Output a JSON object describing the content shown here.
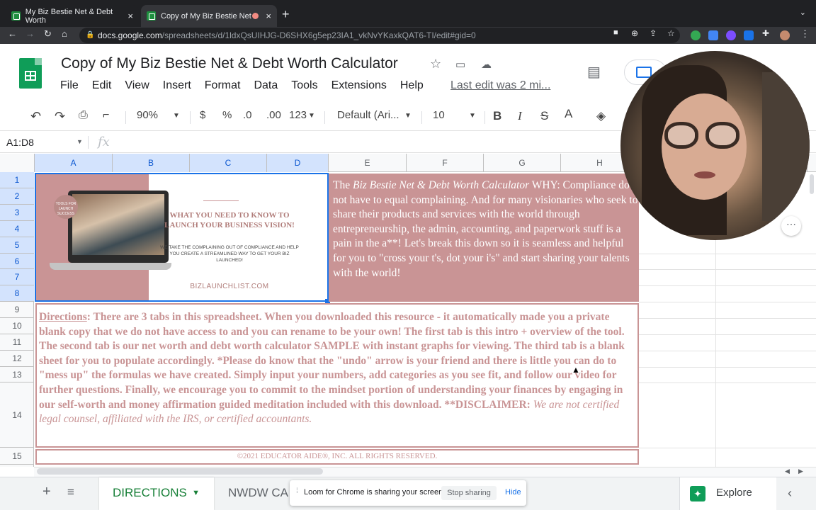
{
  "browser": {
    "tabs": [
      {
        "title": "My Biz Bestie Net & Debt Worth",
        "close": "×"
      },
      {
        "title": "Copy of My Biz Bestie Net",
        "close": "×"
      }
    ],
    "new_tab": "+",
    "url_domain": "docs.google.com",
    "url_path": "/spreadsheets/d/1ldxQsUIHJG-D6SHX6g5ep23IA1_vkNvYKaxkQAT6-TI/edit#gid=0"
  },
  "sheets": {
    "doc_title": "Copy of My Biz Bestie Net & Debt Worth Calculator",
    "menu": [
      "File",
      "Edit",
      "View",
      "Insert",
      "Format",
      "Data",
      "Tools",
      "Extensions",
      "Help"
    ],
    "last_edit": "Last edit was 2 mi...",
    "toolbar": {
      "zoom": "90%",
      "currency": "$",
      "percent": "%",
      "dec_less": ".0",
      "dec_more": ".00",
      "more_formats": "123",
      "font": "Default (Ari...",
      "font_size": "10",
      "bold": "B",
      "italic": "I",
      "strike": "S",
      "text_color": "A"
    },
    "name_box": "A1:D8",
    "fx": "fx",
    "columns": [
      "A",
      "B",
      "C",
      "D",
      "E",
      "F",
      "G",
      "H"
    ],
    "rows": [
      "1",
      "2",
      "3",
      "4",
      "5",
      "6",
      "7",
      "8",
      "9",
      "10",
      "11",
      "12",
      "13",
      "14",
      "15"
    ]
  },
  "image": {
    "badge": "TOOLS FOR LAUNCH SUCCESS",
    "heading": "WHAT YOU NEED TO KNOW TO LAUNCH YOUR BUSINESS VISION!",
    "subheading": "WE TAKE THE COMPLAINING OUT OF COMPLIANCE AND HELP YOU CREATE A STREAMLINED WAY TO GET YOUR BIZ LAUNCHED!",
    "url": "BIZLAUNCHLIST.COM"
  },
  "why": {
    "prefix": "The ",
    "italic": "Biz Bestie Net & Debt Worth Calculator",
    "body": " WHY: Compliance does not have to equal complaining. And for many visionaries who seek to share their products and services with the world through entrepreneurship, the admin, accounting, and paperwork stuff is a pain in the a**! Let's break this down so it is seamless and helpful for you to \"cross your t's, dot your i's\" and start sharing your talents with the world!"
  },
  "directions": {
    "label": "Directions",
    "body": ": There are 3 tabs in this spreadsheet. When you downloaded this resource - it automatically made you a private blank copy that we do not have access to and you can rename to be your own! The first tab is this intro + overview of the tool. The second tab is our net worth and debt worth calculator SAMPLE with instant graphs for viewing. The third tab is a blank sheet for you to populate accordingly. *Please do know that the \"undo\" arrow is your friend and there is little you can do to \"mess up\" the formulas we have created. Simply input your numbers, add categories as you see fit, and follow our video for further questions. Finally, we encourage you to commit to the mindset portion of understanding your finances by engaging in our self-worth and money affirmation guided meditation included with this download. **DISCLAIMER: ",
    "disclaimer": "We are not certified legal counsel, affiliated with the IRS, or certified accountants."
  },
  "copyright": "©2021 EDUCATOR AIDE®, INC. ALL RIGHTS RESERVED.",
  "bottom": {
    "add": "+",
    "all_sheets": "≡",
    "tab_active": "DIRECTIONS",
    "tab_next": "NWDW CA",
    "loom_text": "Loom for Chrome is sharing your screen.",
    "stop_sharing": "Stop sharing",
    "hide": "Hide",
    "explore": "Explore",
    "collapse": "‹"
  }
}
